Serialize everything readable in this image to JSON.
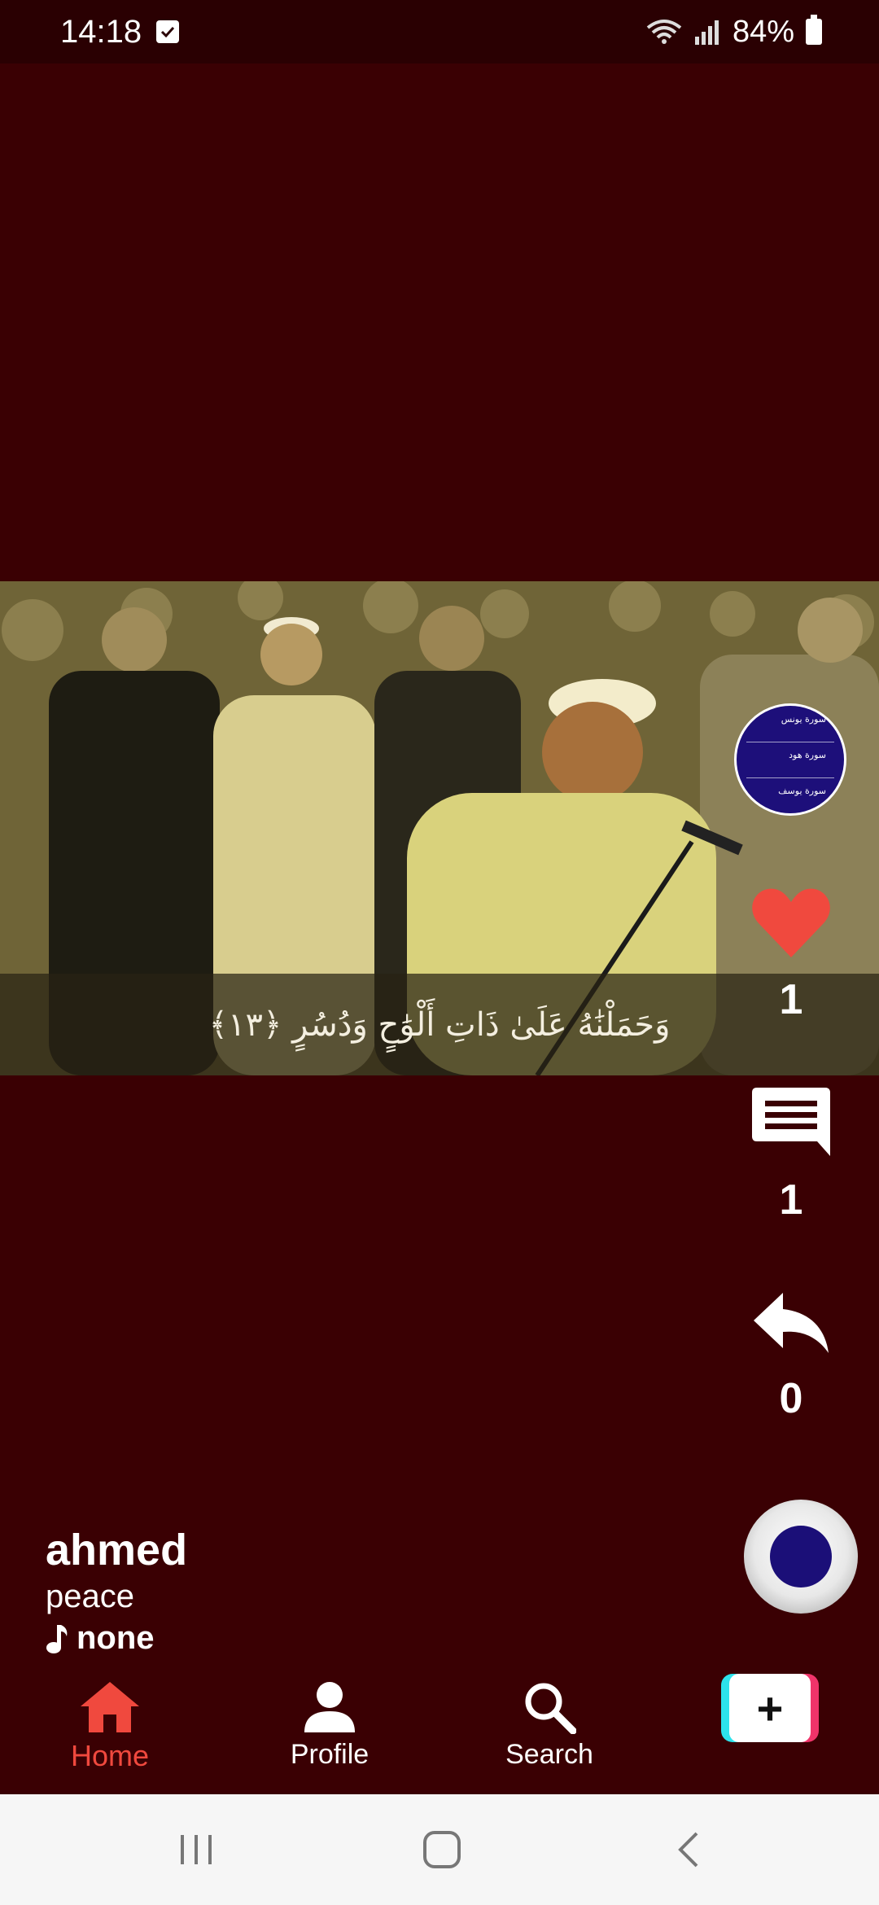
{
  "status_bar": {
    "time": "14:18",
    "battery": "84%"
  },
  "video": {
    "subtitle": "وَحَمَلْنَٰهُ عَلَىٰ ذَاتِ أَلْوَٰحٍ وَدُسُرٍ ﴿١٣﴾"
  },
  "actions": {
    "likes": "1",
    "comments": "1",
    "shares": "0"
  },
  "post": {
    "username": "ahmed",
    "caption": "peace",
    "music": "none"
  },
  "tabs": {
    "home": "Home",
    "profile": "Profile",
    "search": "Search"
  },
  "colors": {
    "background": "#3a0003",
    "accent": "#f0493e",
    "disc": "#1d0f7a"
  }
}
